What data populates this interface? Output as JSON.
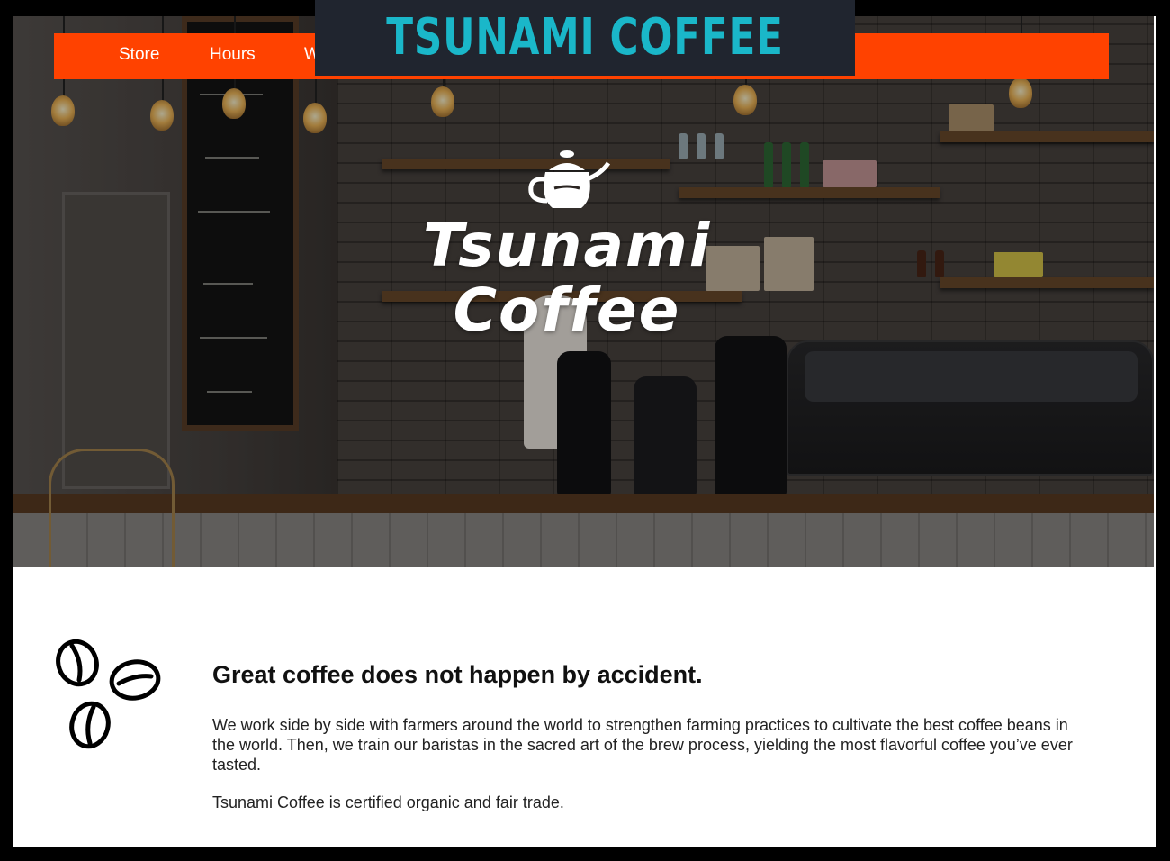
{
  "banner": {
    "title": "TSUNAMI COFFEE"
  },
  "nav": {
    "items": [
      {
        "label": "Store"
      },
      {
        "label": "Hours"
      },
      {
        "label": "W"
      }
    ]
  },
  "hero": {
    "logo_line1": "Tsunami",
    "logo_line2": "Coffee",
    "icon": "kettle-icon"
  },
  "about": {
    "icon": "coffee-beans-icon",
    "headline": "Great coffee does not happen by accident.",
    "paragraph1": "We work side by side with farmers around the world to strengthen farming practices to cultivate the best coffee beans in the world. Then, we train our baristas in the sacred art of the brew process, yielding the most flavorful coffee you’ve ever tasted.",
    "paragraph2": "Tsunami Coffee is certified organic and fair trade."
  },
  "colors": {
    "nav_bg": "#ff4200",
    "banner_bg": "#20252f",
    "banner_text": "#1ab7c9"
  }
}
